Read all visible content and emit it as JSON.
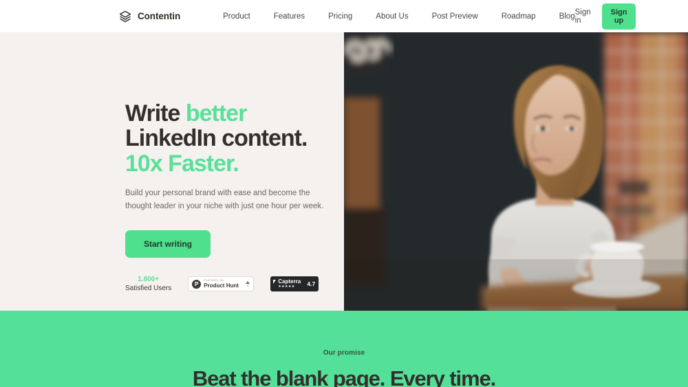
{
  "header": {
    "brand": {
      "name": "Contentin",
      "icon": "layers-icon"
    },
    "nav": [
      {
        "label": "Product"
      },
      {
        "label": "Features"
      },
      {
        "label": "Pricing"
      },
      {
        "label": "About Us"
      },
      {
        "label": "Post Preview"
      },
      {
        "label": "Roadmap"
      },
      {
        "label": "Blog"
      }
    ],
    "signin_label": "Sign in",
    "signup_label": "Sign up"
  },
  "hero": {
    "title_part1": "Write ",
    "title_accent1": "better",
    "title_part2": " LinkedIn content. ",
    "title_accent2": "10x Faster.",
    "subtitle": "Build your personal brand with ease and become the thought leader in your niche with just one hour per week.",
    "cta_label": "Start writing",
    "proof": {
      "count": "1.800+",
      "label": "Satisfied Users",
      "product_hunt": {
        "mark": "P",
        "eyebrow": "FEATURED ON",
        "name": "Product Hunt",
        "votes": "1"
      },
      "capterra": {
        "name": "Capterra",
        "stars": "★★★★★",
        "score": "4.7"
      }
    },
    "photo_alt": "Woman at a cafe desk with laptop and coffee cup"
  },
  "promise": {
    "eyebrow": "Our promise",
    "title": "Beat the blank page. Every time."
  },
  "colors": {
    "accent_green": "#4fe08d",
    "promise_green": "#55e09a",
    "hero_bg": "#f4f1ee",
    "text_dark": "#342f2b",
    "text_muted": "#6c6761"
  }
}
